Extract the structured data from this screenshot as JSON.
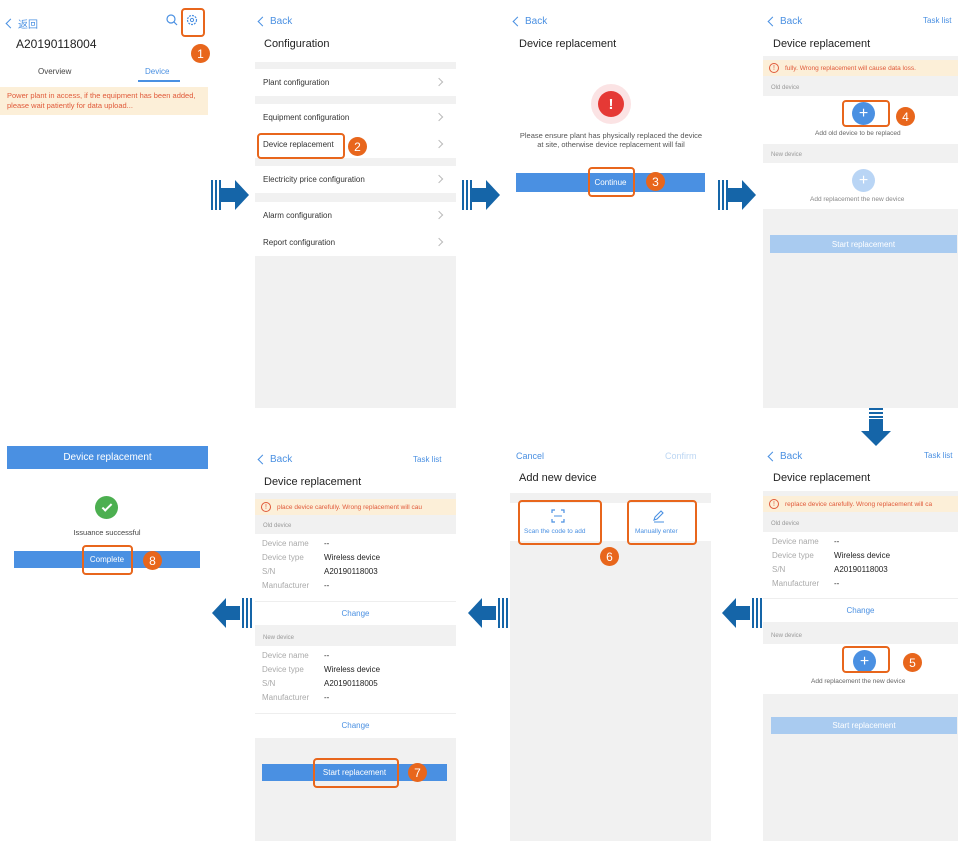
{
  "p1": {
    "back": "返回",
    "device_id": "A20190118004",
    "tabs": [
      "Overview",
      "Device"
    ],
    "notice": "Power plant in access, if the equipment has been added, please wait patiently for data upload...",
    "icons": [
      "search-icon",
      "gear-icon"
    ]
  },
  "p2": {
    "back": "Back",
    "title": "Configuration",
    "items": [
      "Plant configuration",
      "Equipment configuration",
      "Device replacement",
      "Electricity price configuration",
      "Alarm configuration",
      "Report configuration"
    ]
  },
  "p3": {
    "back": "Back",
    "title": "Device replacement",
    "message": "Please ensure plant has physically replaced the device at site, otherwise device replacement will fail",
    "button": "Continue"
  },
  "p4": {
    "back": "Back",
    "task_list": "Task list",
    "title": "Device replacement",
    "warning": "fully. Wrong replacement will cause data loss.",
    "old_label": "Old device",
    "old_caption": "Add old device to be replaced",
    "new_label": "New device",
    "new_caption": "Add replacement the new device",
    "button": "Start replacement"
  },
  "p5": {
    "back": "Back",
    "task_list": "Task list",
    "title": "Device replacement",
    "warning": "replace device carefully. Wrong replacement will ca",
    "old_label": "Old device",
    "fields": [
      {
        "k": "Device name",
        "v": "--"
      },
      {
        "k": "Device type",
        "v": "Wireless device"
      },
      {
        "k": "S/N",
        "v": "A20190118003"
      },
      {
        "k": "Manufacturer",
        "v": "--"
      }
    ],
    "change": "Change",
    "new_label": "New device",
    "new_caption": "Add replacement the new device",
    "button": "Start replacement"
  },
  "p6": {
    "cancel": "Cancel",
    "confirm": "Confirm",
    "title": "Add new device",
    "scan": "Scan the code to add",
    "manual": "Manually enter"
  },
  "p7": {
    "back": "Back",
    "task_list": "Task list",
    "title": "Device replacement",
    "warning": "place device carefully. Wrong replacement will cau",
    "old_label": "Old device",
    "old_fields": [
      {
        "k": "Device name",
        "v": "--"
      },
      {
        "k": "Device type",
        "v": "Wireless device"
      },
      {
        "k": "S/N",
        "v": "A20190118003"
      },
      {
        "k": "Manufacturer",
        "v": "--"
      }
    ],
    "change": "Change",
    "new_label": "New device",
    "new_fields": [
      {
        "k": "Device name",
        "v": "--"
      },
      {
        "k": "Device type",
        "v": "Wireless device"
      },
      {
        "k": "S/N",
        "v": "A20190118005"
      },
      {
        "k": "Manufacturer",
        "v": "--"
      }
    ],
    "button": "Start replacement"
  },
  "p8": {
    "header": "Device replacement",
    "message": "Issuance successful",
    "button": "Complete"
  },
  "steps": [
    "1",
    "2",
    "3",
    "4",
    "5",
    "6",
    "7",
    "8"
  ],
  "colors": {
    "accent": "#4a90e2",
    "highlight": "#e8661c",
    "arrow": "#1565a8",
    "warning_bg": "#fcefd8",
    "warning_text": "#e05a3a",
    "success": "#4caf50"
  }
}
